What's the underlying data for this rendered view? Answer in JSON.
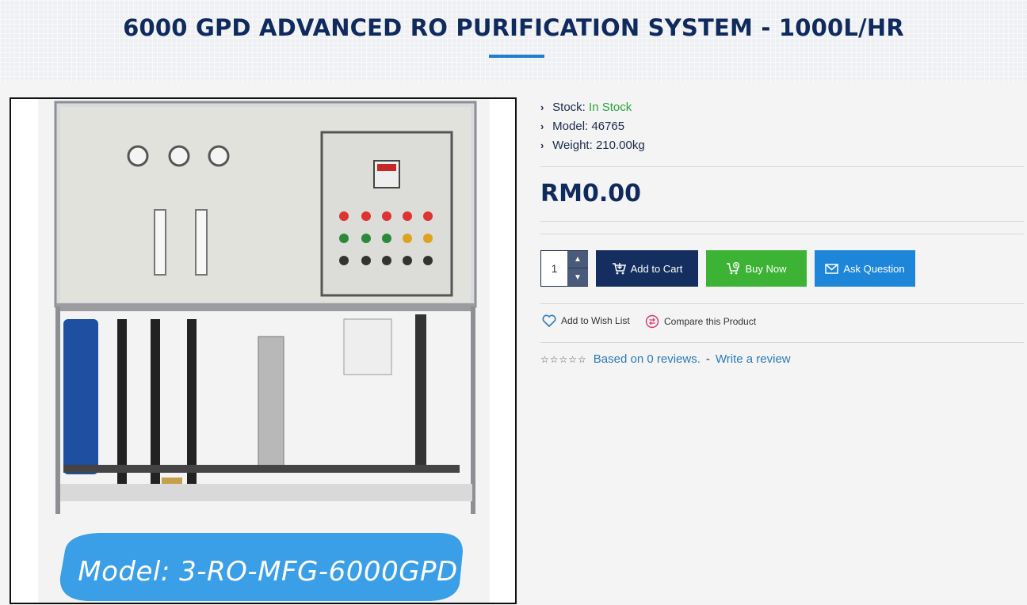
{
  "page": {
    "title": "6000 GPD ADVANCED RO PURIFICATION SYSTEM - 1000L/HR"
  },
  "product_image": {
    "model_caption": "Model: 3-RO-MFG-6000GPD",
    "icon": "product-photo"
  },
  "info": {
    "stock_label": "Stock:",
    "stock_value": "In Stock",
    "model_label": "Model:",
    "model_value": "46765",
    "weight_label": "Weight:",
    "weight_value": "210.00kg"
  },
  "price": "RM0.00",
  "purchase": {
    "quantity": "1",
    "add_to_cart": "Add to Cart",
    "buy_now": "Buy Now",
    "ask_question": "Ask Question"
  },
  "actions": {
    "wish_list": "Add to Wish List",
    "compare": "Compare this Product"
  },
  "reviews": {
    "rating_stars": 0,
    "based_on": "Based on 0 reviews.",
    "separator": "-",
    "write_review": "Write a review"
  },
  "colors": {
    "title": "#0f2a5c",
    "accent_underline": "#1e7fd0",
    "in_stock": "#2aa33a",
    "add_to_cart": "#132e5f",
    "buy_now": "#3cb335",
    "ask_question": "#1e86d8",
    "link": "#2a7ab8"
  }
}
